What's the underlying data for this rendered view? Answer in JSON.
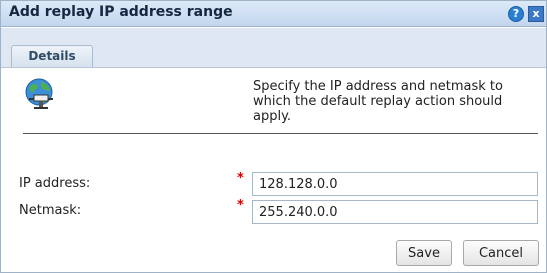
{
  "dialog": {
    "title": "Add replay IP address range",
    "help_icon": "?",
    "close_icon": "x"
  },
  "tabs": [
    {
      "label": "Details",
      "selected": true
    }
  ],
  "content": {
    "icon": "globe-network-icon",
    "description": "Specify the IP address and netmask to which the default replay action should apply."
  },
  "form": {
    "ip_address": {
      "label": "IP address:",
      "value": "128.128.0.0",
      "required_marker": "*"
    },
    "netmask": {
      "label": "Netmask:",
      "value": "255.240.0.0",
      "required_marker": "*"
    }
  },
  "buttons": {
    "save": "Save",
    "cancel": "Cancel"
  },
  "colors": {
    "titlebar": "#c2d6ee",
    "required": "#d00000",
    "border": "#9fb2c6"
  }
}
